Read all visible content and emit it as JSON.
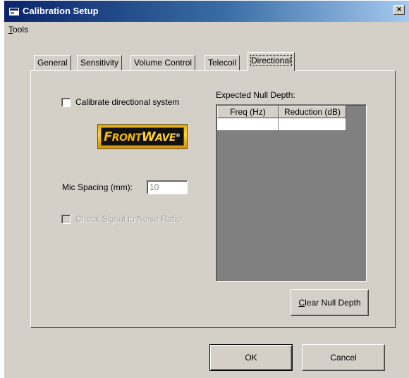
{
  "window": {
    "title": "Calibration Setup",
    "close_glyph": "×",
    "title_icon": "app-icon"
  },
  "menu": {
    "tools_u": "T",
    "tools_rest": "ools"
  },
  "tabs": [
    {
      "label": "General"
    },
    {
      "label": "Sensitivity"
    },
    {
      "label": "Volume Control"
    },
    {
      "label": "Telecoil"
    },
    {
      "label": "Directional",
      "active": true
    }
  ],
  "directional": {
    "calibrate_label": "Calibrate directional system",
    "calibrate_checked": false,
    "logo": {
      "part1_first": "F",
      "part1_rest": "RONT",
      "part2_first": "W",
      "part2_rest": "AVE",
      "mark": "®"
    },
    "mic_spacing_label": "Mic Spacing (mm):",
    "mic_spacing_value": "10",
    "snr_label": "Check Signal to Noise Ratio",
    "snr_checked": false,
    "snr_enabled": false,
    "null_depth_label": "Expected Null Depth:",
    "grid": {
      "columns": [
        "Freq (Hz)",
        "Reduction (dB)"
      ],
      "rows": [
        [
          "",
          ""
        ]
      ]
    },
    "clear_btn_u": "C",
    "clear_btn_rest": "lear Null Depth"
  },
  "buttons": {
    "ok": "OK",
    "cancel": "Cancel"
  },
  "colors": {
    "face": "#d4d0c8",
    "title_start": "#0a246a",
    "title_end": "#a6caf0",
    "grid_bg": "#808080"
  }
}
